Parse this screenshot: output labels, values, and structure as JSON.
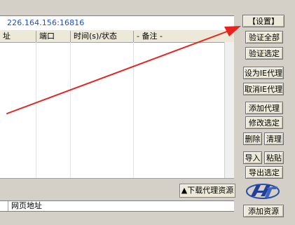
{
  "address": "226.164.156:16816",
  "table": {
    "columns": [
      "址",
      "端口",
      "时间(s)/状态",
      "- 备注 -"
    ]
  },
  "buttons": {
    "settings": "【设置】",
    "verify_all": "验证全部",
    "verify_selected": "验证选定",
    "set_ie_proxy": "设为IE代理",
    "cancel_ie_proxy": "取消IE代理",
    "add_proxy": "添加代理",
    "modify_selected": "修改选定",
    "delete": "删除",
    "clean": "清理",
    "import": "导入",
    "paste": "粘贴",
    "export_selected": "导出选定",
    "add_resource": "添加资源",
    "download_proxy_resources": "▲下载代理资源"
  },
  "web_bar": {
    "label": "网页地址"
  },
  "colors": {
    "arrow": "#e8231e",
    "address_text": "#1a4fd6"
  },
  "icons": {
    "logo": "hdt-logo-icon",
    "arrow": "red-arrow-annotation"
  }
}
